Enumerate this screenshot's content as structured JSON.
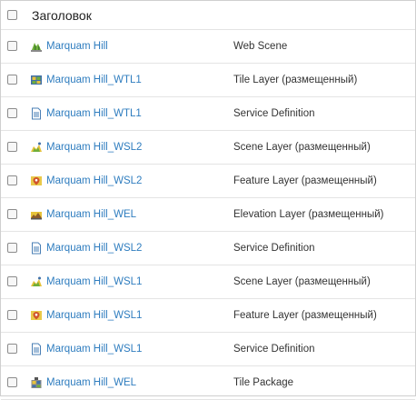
{
  "header": {
    "title": "Заголовок"
  },
  "rows": [
    {
      "title": "Marquam Hill",
      "type": "Web Scene",
      "icon": "web-scene-icon"
    },
    {
      "title": "Marquam Hill_WTL1",
      "type": "Tile Layer (размещенный)",
      "icon": "tile-layer-icon"
    },
    {
      "title": "Marquam Hill_WTL1",
      "type": "Service Definition",
      "icon": "service-definition-icon"
    },
    {
      "title": "Marquam Hill_WSL2",
      "type": "Scene Layer (размещенный)",
      "icon": "scene-layer-icon"
    },
    {
      "title": "Marquam Hill_WSL2",
      "type": "Feature Layer (размещенный)",
      "icon": "feature-layer-icon"
    },
    {
      "title": "Marquam Hill_WEL",
      "type": "Elevation Layer (размещенный)",
      "icon": "elevation-layer-icon"
    },
    {
      "title": "Marquam Hill_WSL2",
      "type": "Service Definition",
      "icon": "service-definition-icon"
    },
    {
      "title": "Marquam Hill_WSL1",
      "type": "Scene Layer (размещенный)",
      "icon": "scene-layer-icon"
    },
    {
      "title": "Marquam Hill_WSL1",
      "type": "Feature Layer (размещенный)",
      "icon": "feature-layer-icon"
    },
    {
      "title": "Marquam Hill_WSL1",
      "type": "Service Definition",
      "icon": "service-definition-icon"
    },
    {
      "title": "Marquam Hill_WEL",
      "type": "Tile Package",
      "icon": "tile-package-icon"
    }
  ]
}
